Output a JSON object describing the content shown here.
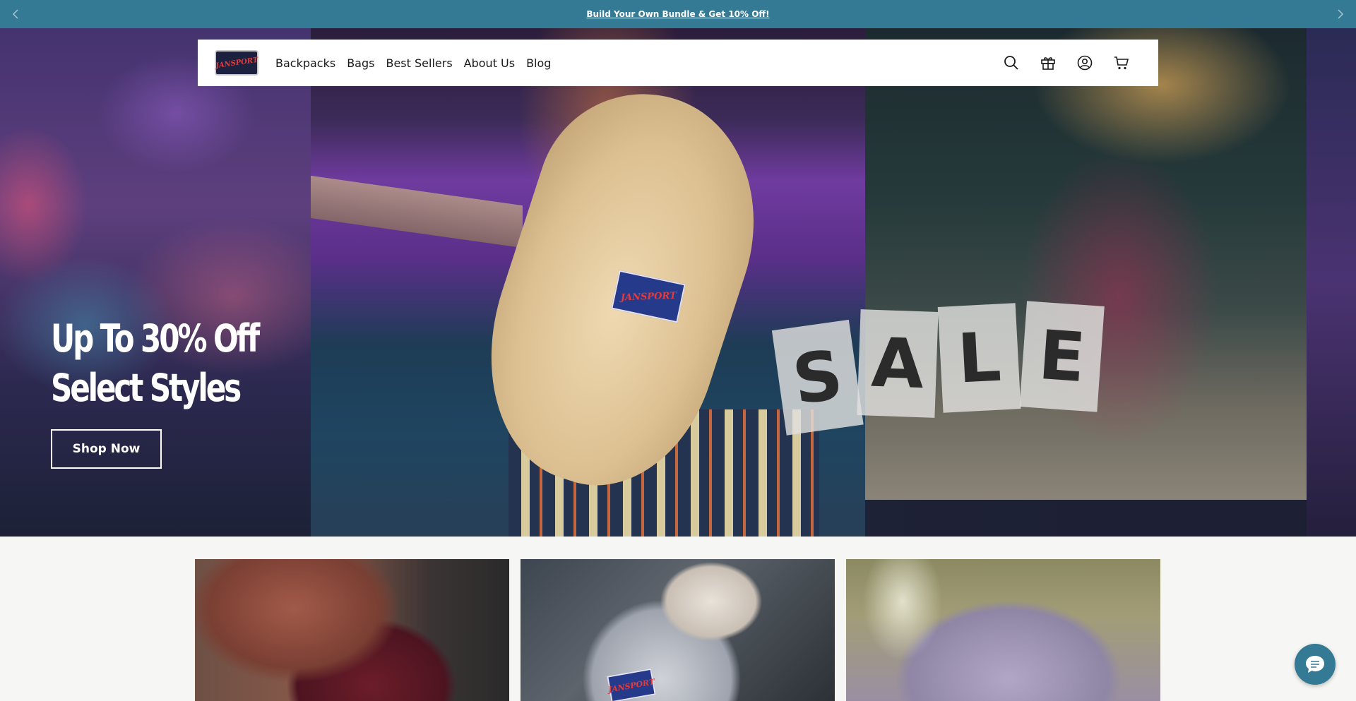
{
  "announcement": {
    "text": "Build Your Own Bundle & Get 10% Off!"
  },
  "header": {
    "logo_text": "JANSPORT",
    "nav": [
      {
        "label": "Backpacks"
      },
      {
        "label": "Bags"
      },
      {
        "label": "Best Sellers"
      },
      {
        "label": "About Us"
      },
      {
        "label": "Blog"
      }
    ],
    "icons": [
      "search-icon",
      "gift-icon",
      "account-icon",
      "cart-icon"
    ]
  },
  "hero": {
    "headline_line1": "Up To 30% Off",
    "headline_line2": "Select Styles",
    "cta_label": "Shop Now",
    "sale_letters": [
      "S",
      "A",
      "L",
      "E"
    ],
    "patch_text": "JANSPORT"
  },
  "cards": [
    {
      "name": "card-maroon-backpack"
    },
    {
      "name": "card-clear-backpack",
      "tag_text": "JANSPORT"
    },
    {
      "name": "card-lavender-backpack"
    }
  ],
  "colors": {
    "announcement_bg": "#347a94",
    "chat_bg": "#347a94",
    "header_bg": "#ffffff",
    "page_bg": "#f6f6f4"
  }
}
